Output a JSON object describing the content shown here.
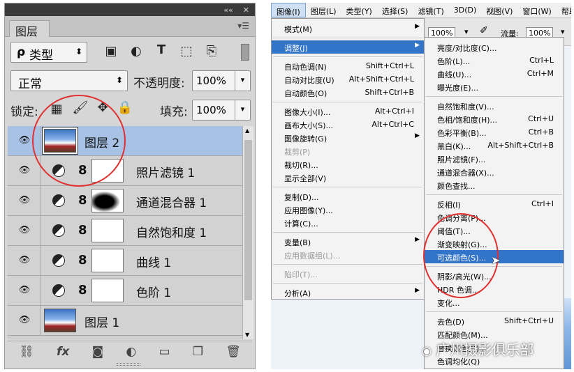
{
  "panel": {
    "top_controls": [
      "««",
      "✕"
    ],
    "tab_label": "图层",
    "tab_menu": "▾☰",
    "filter": {
      "search_glyph": "ρ",
      "label": "类型",
      "stepper": "⬍"
    },
    "filter_icons": [
      "image-filter-icon",
      "adjustment-filter-icon",
      "type-filter-icon",
      "shape-filter-icon",
      "smartobject-filter-icon"
    ],
    "blend_mode": "正常",
    "blend_stepper": "⬍",
    "opacity_label": "不透明度:",
    "opacity_value": "100%",
    "lock_label": "锁定:",
    "fill_label": "填充:",
    "fill_value": "100%",
    "dropdown_arrow": "▾",
    "layers": [
      {
        "name": "图层",
        "num": "2",
        "type": "pixel",
        "selected": true
      },
      {
        "name": "照片滤镜",
        "num": "1",
        "type": "adjustment",
        "selected": false
      },
      {
        "name": "通道混合器",
        "num": "1",
        "type": "adjustment_mask",
        "selected": false
      },
      {
        "name": "自然饱和度",
        "num": "1",
        "type": "adjustment",
        "selected": false
      },
      {
        "name": "曲线",
        "num": "1",
        "type": "adjustment",
        "selected": false
      },
      {
        "name": "色阶",
        "num": "1",
        "type": "adjustment",
        "selected": false
      },
      {
        "name": "图层",
        "num": "1",
        "type": "pixel",
        "selected": false
      }
    ],
    "bottom_icons": [
      "link-icon",
      "fx-icon",
      "mask-icon",
      "adjustment-icon",
      "folder-icon",
      "new-layer-icon",
      "trash-icon"
    ],
    "fx_label": "fx",
    "highlight_color": "#a8c2e6"
  },
  "menubar": [
    "图像(I)",
    "图层(L)",
    "类型(Y)",
    "选择(S)",
    "滤镜(T)",
    "3D(D)",
    "视图(V)",
    "窗口(W)",
    "帮助"
  ],
  "options_bar": {
    "zoom": "100%",
    "flow_label": "流量:",
    "flow": "100%"
  },
  "image_menu": [
    {
      "label": "模式(M)",
      "submenu": true
    },
    {
      "sep": true
    },
    {
      "label": "调整(J)",
      "submenu": true,
      "highlight": true
    },
    {
      "sep": true
    },
    {
      "label": "自动色调(N)",
      "key": "Shift+Ctrl+L"
    },
    {
      "label": "自动对比度(U)",
      "key": "Alt+Shift+Ctrl+L"
    },
    {
      "label": "自动颜色(O)",
      "key": "Shift+Ctrl+B"
    },
    {
      "sep": true
    },
    {
      "label": "图像大小(I)...",
      "key": "Alt+Ctrl+I"
    },
    {
      "label": "画布大小(S)...",
      "key": "Alt+Ctrl+C"
    },
    {
      "label": "图像旋转(G)",
      "submenu": true
    },
    {
      "label": "裁剪(P)",
      "disabled": true
    },
    {
      "label": "裁切(R)..."
    },
    {
      "label": "显示全部(V)"
    },
    {
      "sep": true
    },
    {
      "label": "复制(D)..."
    },
    {
      "label": "应用图像(Y)..."
    },
    {
      "label": "计算(C)..."
    },
    {
      "sep": true
    },
    {
      "label": "变量(B)",
      "submenu": true
    },
    {
      "label": "应用数据组(L)...",
      "disabled": true
    },
    {
      "sep": true
    },
    {
      "label": "陷印(T)...",
      "disabled": true
    },
    {
      "sep": true
    },
    {
      "label": "分析(A)",
      "submenu": true
    }
  ],
  "adjust_menu": [
    {
      "label": "亮度/对比度(C)..."
    },
    {
      "label": "色阶(L)...",
      "key": "Ctrl+L"
    },
    {
      "label": "曲线(U)...",
      "key": "Ctrl+M"
    },
    {
      "label": "曝光度(E)..."
    },
    {
      "sep": true
    },
    {
      "label": "自然饱和度(V)..."
    },
    {
      "label": "色相/饱和度(H)...",
      "key": "Ctrl+U"
    },
    {
      "label": "色彩平衡(B)...",
      "key": "Ctrl+B"
    },
    {
      "label": "黑白(K)...",
      "key": "Alt+Shift+Ctrl+B"
    },
    {
      "label": "照片滤镜(F)..."
    },
    {
      "label": "通道混合器(X)..."
    },
    {
      "label": "颜色查找..."
    },
    {
      "sep": true
    },
    {
      "label": "反相(I)",
      "key": "Ctrl+I"
    },
    {
      "label": "色调分离(P)..."
    },
    {
      "label": "阈值(T)..."
    },
    {
      "label": "渐变映射(G)..."
    },
    {
      "label": "可选颜色(S)...",
      "highlight": true
    },
    {
      "sep": true
    },
    {
      "label": "阴影/高光(W)..."
    },
    {
      "label": "HDR 色调..."
    },
    {
      "label": "变化..."
    },
    {
      "sep": true
    },
    {
      "label": "去色(D)",
      "key": "Shift+Ctrl+U"
    },
    {
      "label": "匹配颜色(M)..."
    },
    {
      "label": "替换颜色(R)..."
    },
    {
      "label": "色调均化(Q)"
    }
  ],
  "watermark": "广州摄影俱乐部"
}
